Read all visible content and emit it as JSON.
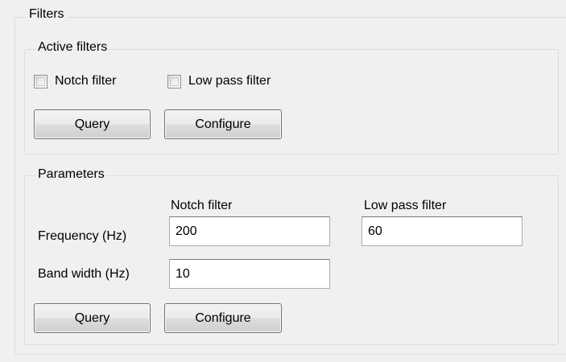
{
  "filters": {
    "legend": "Filters",
    "active_filters": {
      "legend": "Active filters",
      "notch_checkbox": {
        "label": "Notch filter",
        "checked": false
      },
      "lowpass_checkbox": {
        "label": "Low pass filter",
        "checked": false
      },
      "query_label": "Query",
      "configure_label": "Configure"
    },
    "parameters": {
      "legend": "Parameters",
      "col_notch": "Notch filter",
      "col_lowpass": "Low pass filter",
      "frequency_label": "Frequency (Hz)",
      "frequency_notch_value": "200",
      "frequency_lowpass_value": "60",
      "bandwidth_label": "Band width (Hz)",
      "bandwidth_notch_value": "10",
      "query_label": "Query",
      "configure_label": "Configure"
    }
  }
}
